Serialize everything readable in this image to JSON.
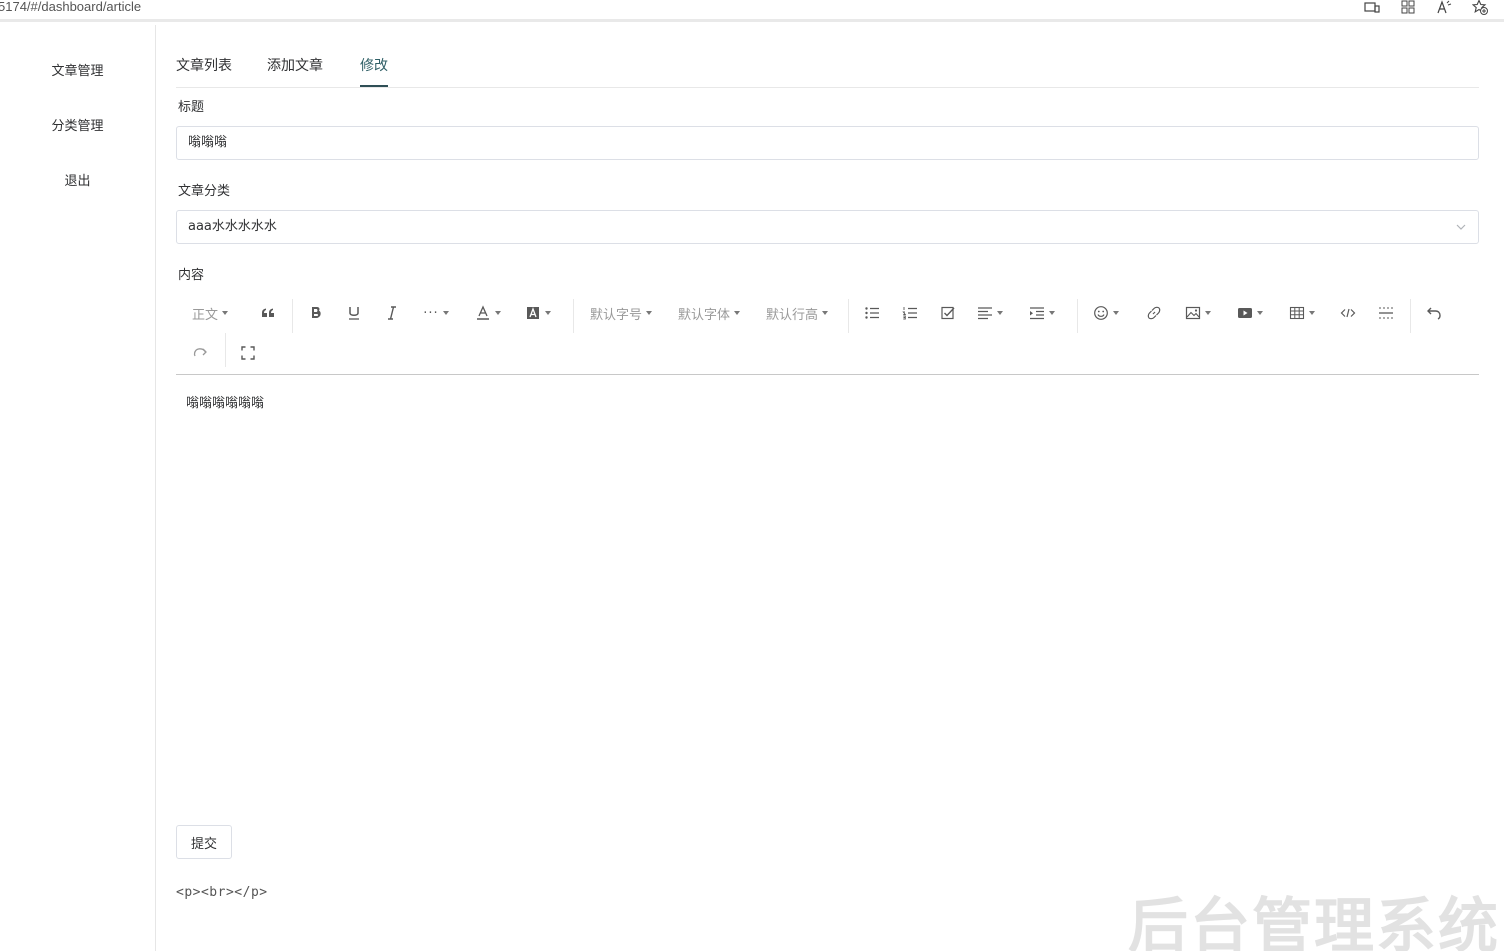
{
  "browser": {
    "url": "5174/#/dashboard/article",
    "icons": [
      "device-icon",
      "apps-icon",
      "read-aloud-icon",
      "favorite-add-icon"
    ]
  },
  "sidebar": {
    "items": [
      {
        "label": "文章管理"
      },
      {
        "label": "分类管理"
      },
      {
        "label": "退出"
      }
    ]
  },
  "tabs": [
    {
      "label": "文章列表",
      "active": false
    },
    {
      "label": "添加文章",
      "active": false
    },
    {
      "label": "修改",
      "active": true
    }
  ],
  "form": {
    "title_label": "标题",
    "title_value": "嗡嗡嗡",
    "category_label": "文章分类",
    "category_value": "aaa水水水水水",
    "content_label": "内容"
  },
  "editor": {
    "toolbar": {
      "paragraph": "正文",
      "font_size": "默认字号",
      "font_family": "默认字体",
      "line_height": "默认行高"
    },
    "content": "嗡嗡嗡嗡嗡嗡"
  },
  "submit_label": "提交",
  "html_output": "<p><br></p>",
  "watermark": "后台管理系统",
  "colors": {
    "active_tab": "#2f5f66",
    "border": "#dcdfe6"
  }
}
